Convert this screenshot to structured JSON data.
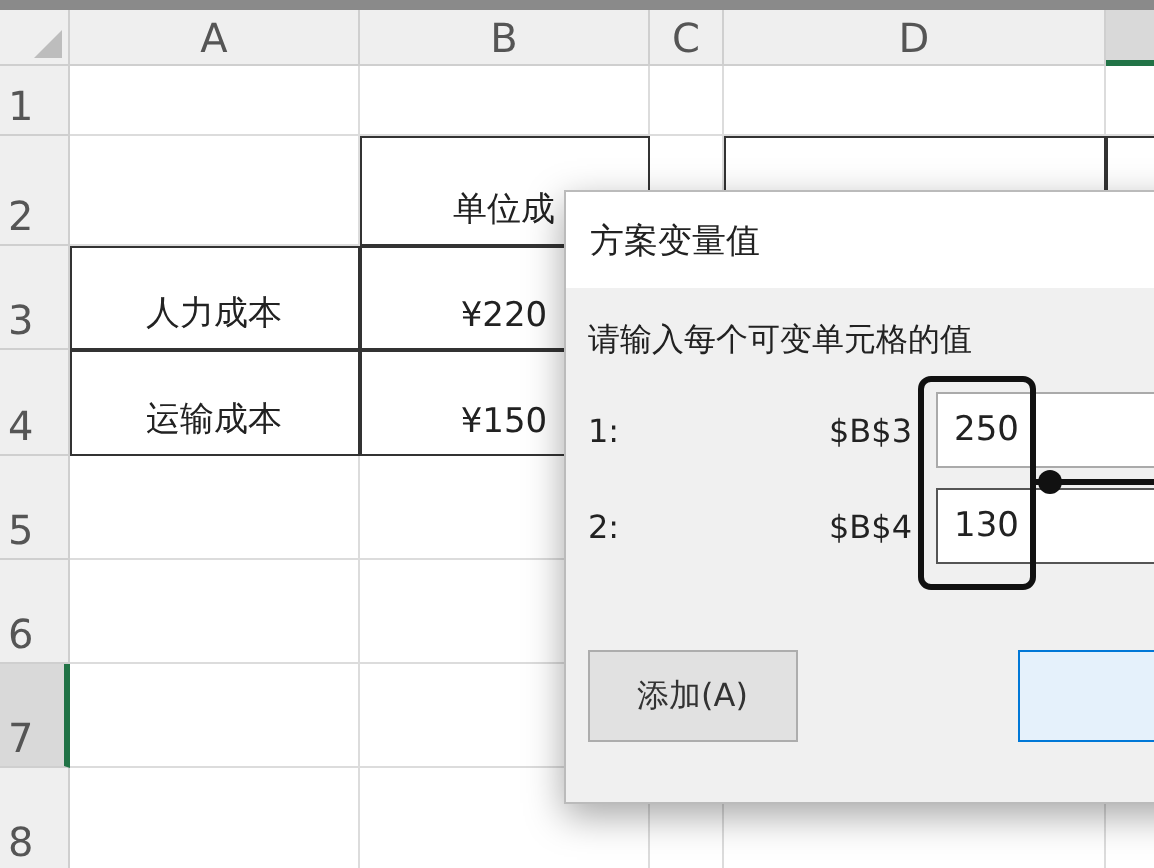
{
  "columns": [
    {
      "label": "A",
      "selected": false
    },
    {
      "label": "B",
      "selected": false
    },
    {
      "label": "C",
      "selected": false
    },
    {
      "label": "D",
      "selected": false
    },
    {
      "selected": true
    }
  ],
  "rows": [
    {
      "label": "1",
      "selected": false,
      "cells": [
        {
          "bordered": false
        },
        {
          "bordered": false
        },
        {
          "bordered": false
        },
        {
          "bordered": false
        },
        {
          "bordered": false
        }
      ]
    },
    {
      "label": "2",
      "selected": false,
      "cells": [
        {
          "bordered": false
        },
        {
          "text": "单位成",
          "bordered": true
        },
        {
          "bordered": false
        },
        {
          "bordered": true
        },
        {
          "bordered": true
        }
      ]
    },
    {
      "label": "3",
      "selected": false,
      "cells": [
        {
          "text": "人力成本",
          "bordered": true
        },
        {
          "text": "¥220",
          "bordered": true
        },
        {},
        {},
        {}
      ]
    },
    {
      "label": "4",
      "selected": false,
      "cells": [
        {
          "text": "运输成本",
          "bordered": true
        },
        {
          "text": "¥150",
          "bordered": true
        },
        {},
        {},
        {}
      ]
    },
    {
      "label": "5",
      "selected": false,
      "cells": [
        {
          "bordered": false
        },
        {
          "bordered": false
        },
        {},
        {},
        {}
      ]
    },
    {
      "label": "6",
      "selected": false,
      "cells": [
        {
          "bordered": false
        },
        {
          "bordered": false
        },
        {},
        {},
        {}
      ]
    },
    {
      "label": "7",
      "selected": true,
      "cells": [
        {
          "bordered": false
        },
        {
          "bordered": false
        },
        {},
        {},
        {}
      ]
    },
    {
      "label": "8",
      "selected": false,
      "cells": [
        {
          "bordered": false
        },
        {
          "bordered": false
        },
        {
          "bordered": false
        },
        {
          "bordered": false
        },
        {
          "bordered": false
        }
      ]
    }
  ],
  "dialog": {
    "title": "方案变量值",
    "prompt": "请输入每个可变单元格的值",
    "variables": [
      {
        "label": "1:",
        "cell": "$B$3",
        "value": "250",
        "focused": false
      },
      {
        "label": "2:",
        "cell": "$B$4",
        "value": "130",
        "focused": true
      }
    ],
    "buttons": [
      {
        "label": "添加(A)",
        "default": false
      },
      {
        "default": true
      }
    ]
  }
}
